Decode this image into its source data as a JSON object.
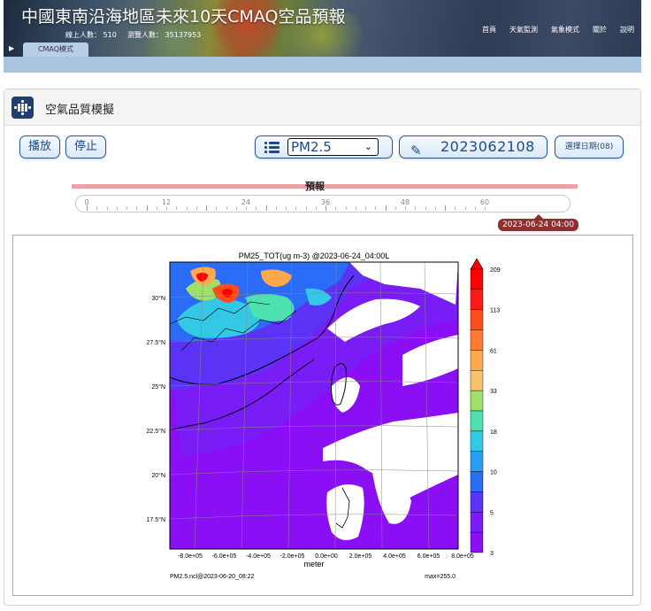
{
  "header": {
    "site_title": "中國東南沿海地區未來10天CMAQ空品預報",
    "online_label": "線上人數：",
    "online_count": "510",
    "visits_label": "瀏覽人數：",
    "visits_count": "35137953",
    "nav": [
      "首頁",
      "天氣監測",
      "氣象模式",
      "關於",
      "說明"
    ],
    "active_tab": "CMAQ模式"
  },
  "panel": {
    "title": "空氣品質模擬"
  },
  "controls": {
    "play_label": "播放",
    "stop_label": "停止",
    "species_selected": "PM2.5",
    "date_value": "2023062108",
    "pick_date_label": "選擇日期(08)"
  },
  "timeline": {
    "title": "預報",
    "tick_labels": [
      "0",
      "12",
      "24",
      "36",
      "48",
      "60"
    ],
    "current_time": "2023-06-24 04:00"
  },
  "map": {
    "title": "PM25_TOT(ug m-3) @2023-06-24_04:00L",
    "y_tick_labels": [
      "30°N",
      "27.5°N",
      "25°N",
      "22.5°N",
      "20°N",
      "17.5°N"
    ],
    "x_tick_labels": [
      "-8.0e+05",
      "-6.0e+05",
      "-4.0e+05",
      "-2.0e+05",
      "0.0e+00",
      "2.0e+05",
      "4.0e+05",
      "6.0e+05",
      "8.0e+05"
    ],
    "x_axis_label": "meter",
    "footer_left": "PM2.5.ncl@2023-06-20_08:22",
    "footer_right": "max=255.0",
    "colorbar_labels": [
      "209",
      "113",
      "61",
      "33",
      "18",
      "10",
      "5",
      "3"
    ],
    "colorbar_colors": [
      "#ff0000",
      "#ff1a1a",
      "#ff4d1a",
      "#ff7a33",
      "#ffa84d",
      "#f5c36b",
      "#9ee06b",
      "#4de0b0",
      "#33c8e6",
      "#2a9ef0",
      "#2a6cf5",
      "#5a33f5",
      "#7a1cf5",
      "#8a0ff5"
    ]
  }
}
